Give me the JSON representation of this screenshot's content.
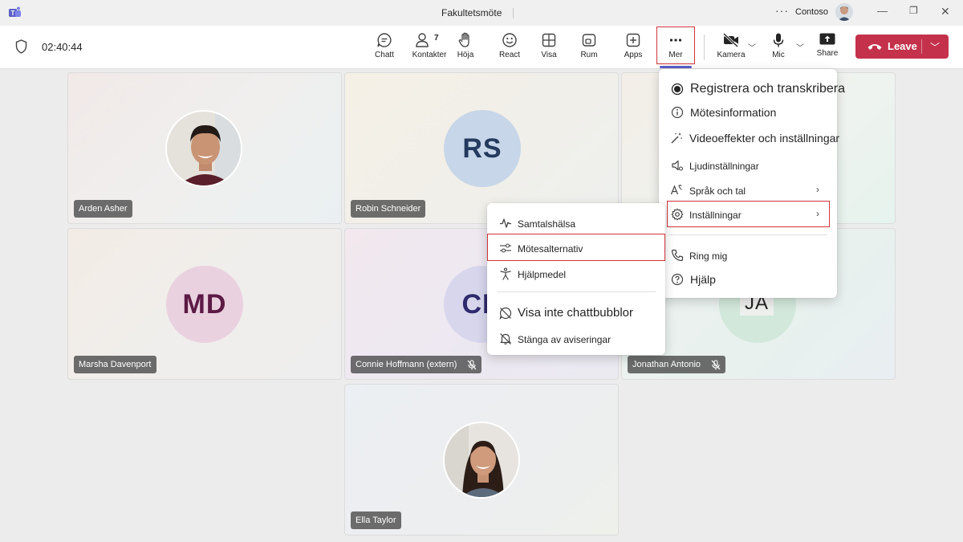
{
  "titlebar": {
    "title": "Fakultetsmöte",
    "more_icon": "ellipsis-icon",
    "org": "Contoso",
    "window_controls": [
      "minimize-icon",
      "restore-icon",
      "close-icon"
    ]
  },
  "controls": {
    "timer": "02:40:44",
    "chat": "Chatt",
    "people": "Kontakter",
    "people_count": "7",
    "raise": "Höja",
    "react": "React",
    "view": "Visa",
    "rooms": "Rum",
    "apps": "Apps",
    "more": "Mer",
    "camera": "Kamera",
    "mic": "Mic",
    "share": "Share",
    "leave": "Leave"
  },
  "colors": {
    "leave": "#c4314b",
    "highlight": "#d13438",
    "accent": "#5b5fc7"
  },
  "participants": [
    {
      "name": "Arden Asher",
      "type": "photo",
      "muted": false
    },
    {
      "name": "Robin Schneider",
      "initials": "RS",
      "muted": false
    },
    {
      "name": "Marsha Davenport",
      "initials": "MD",
      "muted": false
    },
    {
      "name": "Connie Hoffmann (extern)",
      "initials": "CH",
      "muted": true
    },
    {
      "name": "Jonathan Antonio",
      "initials": "JA",
      "muted": true
    },
    {
      "name": "Ella Taylor",
      "type": "photo",
      "muted": false
    }
  ],
  "more_menu": {
    "items": [
      {
        "label": "Registrera och transkribera",
        "icon": "record-icon"
      },
      {
        "label": "Mötesinformation",
        "icon": "info-icon"
      },
      {
        "label": "Videoeffekter och inställningar",
        "icon": "magic-wand-icon"
      },
      {
        "label": "Ljudinställningar",
        "icon": "speaker-settings-icon"
      },
      {
        "label": "Språk och tal",
        "icon": "language-icon",
        "submenu": true
      },
      {
        "label": "Inställningar",
        "icon": "gear-icon",
        "submenu": true,
        "highlighted": true
      },
      {
        "label": "Ring mig",
        "icon": "phone-icon"
      },
      {
        "label": "Hjälp",
        "icon": "help-icon"
      }
    ]
  },
  "settings_submenu": {
    "items": [
      {
        "label": "Samtalshälsa",
        "icon": "pulse-icon"
      },
      {
        "label": "Mötesalternativ",
        "icon": "sliders-icon",
        "highlighted": true
      },
      {
        "label": "Hjälpmedel",
        "icon": "accessibility-icon"
      },
      {
        "label": "Visa inte chattbubblor",
        "icon": "chat-off-icon"
      },
      {
        "label": "Stänga av aviseringar",
        "icon": "bell-off-icon"
      }
    ]
  }
}
